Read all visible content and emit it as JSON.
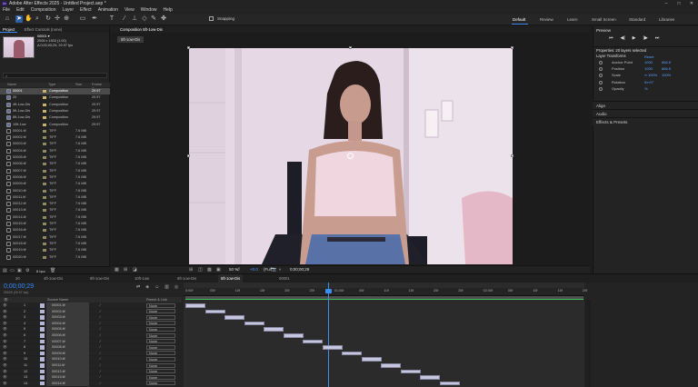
{
  "window": {
    "title": "Adobe After Effects 2025 - Untitled Project.aep *",
    "logo": "Ae",
    "controls": [
      "–",
      "□",
      "✕"
    ]
  },
  "menu": [
    "File",
    "Edit",
    "Composition",
    "Layer",
    "Effect",
    "Animation",
    "View",
    "Window",
    "Help"
  ],
  "toolbar": {
    "tools": [
      "home-icon",
      "arrow-icon",
      "hand-icon",
      "zoom-icon",
      "rotate-icon",
      "camera-icon",
      "pan-icon",
      "rect-icon",
      "pen-icon",
      "type-icon",
      "brush-icon",
      "stamp-icon",
      "eraser-icon",
      "roto-icon",
      "puppet-icon"
    ],
    "snapping_label": "Snapping"
  },
  "workspaces": [
    "Default",
    "Review",
    "Learn",
    "Small Screen",
    "Standard",
    "Libraries"
  ],
  "project": {
    "tabs": [
      "Project",
      "Effect Controls (none)"
    ],
    "selected_name": "00001 ▾",
    "meta": [
      "2006 x 1533 (1.00)",
      "Δ 0;00;00;29, 29.97 fps"
    ],
    "search_placeholder": "⌕",
    "columns": [
      "Name",
      "Type",
      "Size",
      "Frame Ra..."
    ],
    "items": [
      {
        "name": "00001",
        "type": "Composition",
        "size": "",
        "fr": "29.97",
        "comp": true,
        "sel": true
      },
      {
        "name": "20",
        "type": "Composition",
        "size": "",
        "fr": "29.97",
        "comp": true
      },
      {
        "name": "4ft-1ow-Dis",
        "type": "Composition",
        "size": "",
        "fr": "29.97",
        "comp": true
      },
      {
        "name": "5ft-1ow-Dis",
        "type": "Composition",
        "size": "",
        "fr": "29.97",
        "comp": true
      },
      {
        "name": "8ft-1ow-Dis",
        "type": "Composition",
        "size": "",
        "fr": "29.97",
        "comp": true
      },
      {
        "name": "10ft-1ow",
        "type": "Composition",
        "size": "",
        "fr": "29.97",
        "comp": true
      },
      {
        "name": "00001.tif",
        "type": "TIFF",
        "size": "7.6 MB",
        "fr": ""
      },
      {
        "name": "00002.tif",
        "type": "TIFF",
        "size": "7.6 MB",
        "fr": ""
      },
      {
        "name": "00003.tif",
        "type": "TIFF",
        "size": "7.6 MB",
        "fr": ""
      },
      {
        "name": "00004.tif",
        "type": "TIFF",
        "size": "7.6 MB",
        "fr": ""
      },
      {
        "name": "00005.tif",
        "type": "TIFF",
        "size": "7.6 MB",
        "fr": ""
      },
      {
        "name": "00006.tif",
        "type": "TIFF",
        "size": "7.6 MB",
        "fr": ""
      },
      {
        "name": "00007.tif",
        "type": "TIFF",
        "size": "7.6 MB",
        "fr": ""
      },
      {
        "name": "00008.tif",
        "type": "TIFF",
        "size": "7.6 MB",
        "fr": ""
      },
      {
        "name": "00009.tif",
        "type": "TIFF",
        "size": "7.6 MB",
        "fr": ""
      },
      {
        "name": "00010.tif",
        "type": "TIFF",
        "size": "7.6 MB",
        "fr": ""
      },
      {
        "name": "00011.tif",
        "type": "TIFF",
        "size": "7.6 MB",
        "fr": ""
      },
      {
        "name": "00012.tif",
        "type": "TIFF",
        "size": "7.6 MB",
        "fr": ""
      },
      {
        "name": "00013.tif",
        "type": "TIFF",
        "size": "7.6 MB",
        "fr": ""
      },
      {
        "name": "00014.tif",
        "type": "TIFF",
        "size": "7.6 MB",
        "fr": ""
      },
      {
        "name": "00015.tif",
        "type": "TIFF",
        "size": "7.6 MB",
        "fr": ""
      },
      {
        "name": "00016.tif",
        "type": "TIFF",
        "size": "7.6 MB",
        "fr": ""
      },
      {
        "name": "00017.tif",
        "type": "TIFF",
        "size": "7.6 MB",
        "fr": ""
      },
      {
        "name": "00018.tif",
        "type": "TIFF",
        "size": "7.6 MB",
        "fr": ""
      },
      {
        "name": "00019.tif",
        "type": "TIFF",
        "size": "7.6 MB",
        "fr": ""
      },
      {
        "name": "00020.tif",
        "type": "TIFF",
        "size": "7.6 MB",
        "fr": ""
      }
    ],
    "bpc": "8 bpc"
  },
  "composition": {
    "tab": "Composition 5ft-1ow-Dis",
    "chip": "5ft-1ow-Dis",
    "footer": {
      "zoom": "50 %",
      "resolution": "(Full)",
      "exposure": "+0.0",
      "timecode": "0;00;00;29"
    }
  },
  "preview": {
    "title": "Preview",
    "controls": [
      "⏮",
      "◀|",
      "▶",
      "|▶",
      "⏭"
    ]
  },
  "properties": {
    "title": "Properties: 20 layers selected",
    "section": "Layer Transforms",
    "reset": "Reset",
    "rows": [
      {
        "label": "Anchor Point",
        "v1": "1000",
        "v2": "666.5"
      },
      {
        "label": "Position",
        "v1": "1000",
        "v2": "666.5"
      },
      {
        "label": "Scale",
        "v1": "∞ 100%",
        "v2": "100%"
      },
      {
        "label": "Rotation",
        "v1": "0x+0°",
        "v2": ""
      },
      {
        "label": "Opacity",
        "v1": "%",
        "v2": ""
      }
    ],
    "accordions": [
      "Align",
      "Audio",
      "Effects & Presets"
    ]
  },
  "timeline": {
    "tabs": [
      "20",
      "4ft-1ow-Dis",
      "8ft-1ow-Dis",
      "10ft-1ow",
      "6ft-1ow-Dis",
      "5ft-1ow-Dis",
      "00001"
    ],
    "timecode": "0;00;00;29",
    "frames": "00029 (29.97 fps)",
    "columns": [
      "Source Name",
      "Parent & Link"
    ],
    "ruler": [
      "0:00f",
      "05f",
      "10f",
      "15f",
      "20f",
      "25f",
      "01:00f",
      "05f",
      "10f",
      "15f",
      "20f",
      "25f",
      "02:00f",
      "05f",
      "10f",
      "15f",
      "20f"
    ],
    "layers": [
      {
        "num": "1",
        "name": "00001.tif",
        "parent": "None"
      },
      {
        "num": "2",
        "name": "00002.tif",
        "parent": "None"
      },
      {
        "num": "3",
        "name": "00003.tif",
        "parent": "None"
      },
      {
        "num": "4",
        "name": "00004.tif",
        "parent": "None"
      },
      {
        "num": "5",
        "name": "00005.tif",
        "parent": "None"
      },
      {
        "num": "6",
        "name": "00006.tif",
        "parent": "None"
      },
      {
        "num": "7",
        "name": "00007.tif",
        "parent": "None"
      },
      {
        "num": "8",
        "name": "00008.tif",
        "parent": "None"
      },
      {
        "num": "9",
        "name": "00009.tif",
        "parent": "None"
      },
      {
        "num": "10",
        "name": "00010.tif",
        "parent": "None"
      },
      {
        "num": "11",
        "name": "00011.tif",
        "parent": "None"
      },
      {
        "num": "12",
        "name": "00012.tif",
        "parent": "None"
      },
      {
        "num": "13",
        "name": "00013.tif",
        "parent": "None"
      },
      {
        "num": "14",
        "name": "00014.tif",
        "parent": "None"
      }
    ]
  }
}
